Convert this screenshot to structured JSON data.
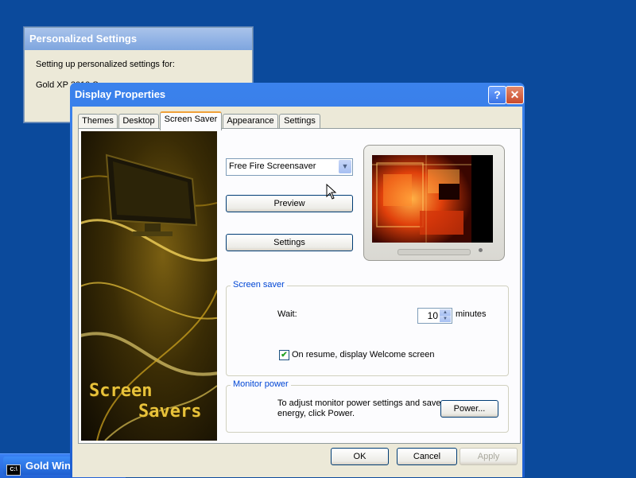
{
  "background_window": {
    "title": "Personalized Settings",
    "line1": "Setting up personalized settings for:",
    "line2": "Gold XP 2010 Se..."
  },
  "taskbar": {
    "item_label": "Gold Win...",
    "icon": "cmd-icon"
  },
  "dialog": {
    "title": "Display Properties",
    "help_label": "?",
    "close_label": "✕",
    "tabs": [
      {
        "label": "Themes",
        "selected": false
      },
      {
        "label": "Desktop",
        "selected": false
      },
      {
        "label": "Screen Saver",
        "selected": true
      },
      {
        "label": "Appearance",
        "selected": false
      },
      {
        "label": "Settings",
        "selected": false
      }
    ],
    "art": {
      "line1": "Screen",
      "line2": "Savers"
    },
    "screensaver_select": {
      "value": "Free Fire Screensaver"
    },
    "preview_button": "Preview",
    "settings_button": "Settings",
    "screen_saver_group": {
      "label": "Screen saver",
      "wait_label": "Wait:",
      "wait_value": "10",
      "minutes_label": "minutes",
      "welcome_checkbox": {
        "label": "On resume, display Welcome screen",
        "checked": true
      }
    },
    "monitor_power_group": {
      "label": "Monitor power",
      "line1": "To adjust monitor power settings and save",
      "line2": "energy, click Power.",
      "power_button": "Power..."
    },
    "ok_button": "OK",
    "cancel_button": "Cancel",
    "apply_button": "Apply"
  },
  "colors": {
    "desktop": "#0b4a9c",
    "titlebar": "#1e5fd1",
    "dialog_face": "#ece9d8",
    "group_label": "#0046d5",
    "tab_highlight": "#f0a13a"
  }
}
